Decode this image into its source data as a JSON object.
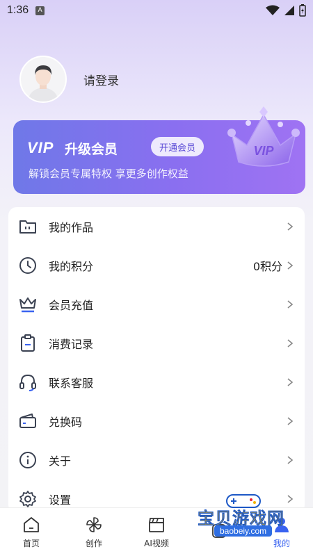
{
  "status": {
    "time": "1:36",
    "a_badge": "A"
  },
  "profile": {
    "login": "请登录"
  },
  "vip": {
    "logo": "VIP",
    "title": "升级会员",
    "button": "开通会员",
    "subtitle": "解锁会员专属特权 享更多创作权益",
    "crown_text": "VIP"
  },
  "menu": {
    "items": [
      {
        "label": "我的作品",
        "icon": "folder-icon"
      },
      {
        "label": "我的积分",
        "value": "0积分",
        "icon": "clock-icon"
      },
      {
        "label": "会员充值",
        "icon": "crown-icon"
      },
      {
        "label": "消费记录",
        "icon": "clipboard-icon"
      },
      {
        "label": "联系客服",
        "icon": "headset-icon"
      },
      {
        "label": "兑换码",
        "icon": "wallet-icon"
      },
      {
        "label": "关于",
        "icon": "info-icon"
      },
      {
        "label": "设置",
        "icon": "gear-icon"
      }
    ]
  },
  "tabs": [
    {
      "label": "首页",
      "icon": "home-icon"
    },
    {
      "label": "创作",
      "icon": "pinwheel-icon"
    },
    {
      "label": "AI视频",
      "icon": "clapperboard-icon"
    },
    {
      "label": "",
      "icon": "shape-icon"
    },
    {
      "label": "我的",
      "icon": "user-icon",
      "active": true
    }
  ],
  "watermark": {
    "text": "宝贝游戏网",
    "url": "baobeiy.com"
  },
  "colors": {
    "accent": "#3a63f0",
    "vip_start": "#6f78e8",
    "vip_end": "#9f73f3"
  }
}
